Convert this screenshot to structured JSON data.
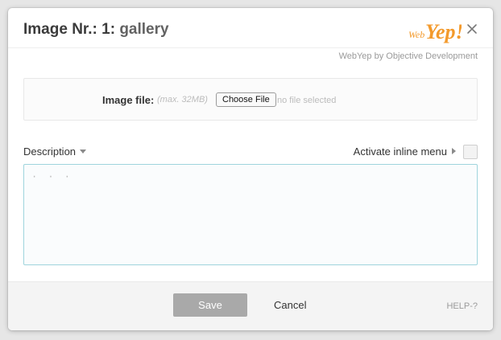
{
  "dialog": {
    "title_prefix": "Image Nr.: 1:",
    "title_name": "gallery",
    "logo_small_text": "Web",
    "logo_big_text": "Yep!",
    "close_icon": "close-icon",
    "subtitle": "WebYep by Objective Development"
  },
  "upload": {
    "label": "Image file:",
    "hint": "(max. 32MB)",
    "button_label": "Choose File",
    "status": "no file selected"
  },
  "description": {
    "label": "Description",
    "inline_menu_label": "Activate inline menu",
    "inline_menu_checked": false,
    "text": "· · ·"
  },
  "footer": {
    "save_label": "Save",
    "cancel_label": "Cancel",
    "help_label": "HELP-?"
  },
  "colors": {
    "logo_orange": "#f39a2c",
    "textarea_border": "#9fd4dd",
    "save_button_bg": "#a9a9a9"
  }
}
